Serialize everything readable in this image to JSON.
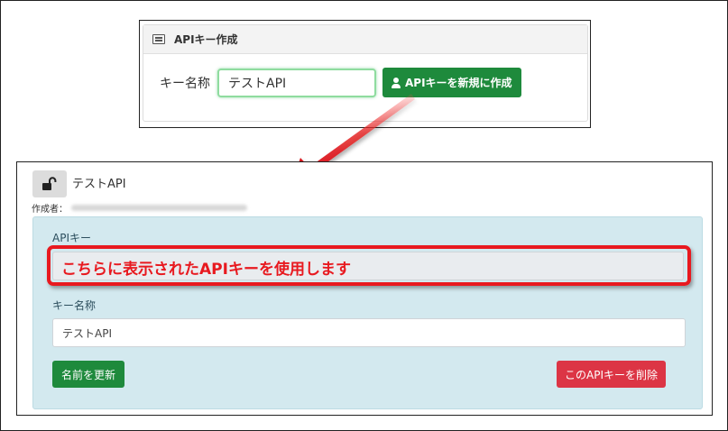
{
  "create_panel": {
    "header_title": "APIキー作成",
    "key_name_label": "キー名称",
    "key_name_value": "テストAPI",
    "create_button_label": "APIキーを新規に作成"
  },
  "key_detail": {
    "key_title": "テストAPI",
    "creator_label": "作成者：",
    "api_key_label": "APIキー",
    "api_key_annotation": "こちらに表示されたAPIキーを使用します",
    "name_label": "キー名称",
    "name_value": "テストAPI",
    "update_button_label": "名前を更新",
    "delete_button_label": "このAPIキーを削除"
  },
  "colors": {
    "success_green": "#1e8a3c",
    "danger_red": "#dc3545",
    "info_bg": "#d3e9ef",
    "annotation_red": "#e8191f"
  },
  "icons": {
    "header_icon": "list-icon",
    "create_button_icon": "user-icon",
    "key_status_icon": "unlock-icon"
  }
}
